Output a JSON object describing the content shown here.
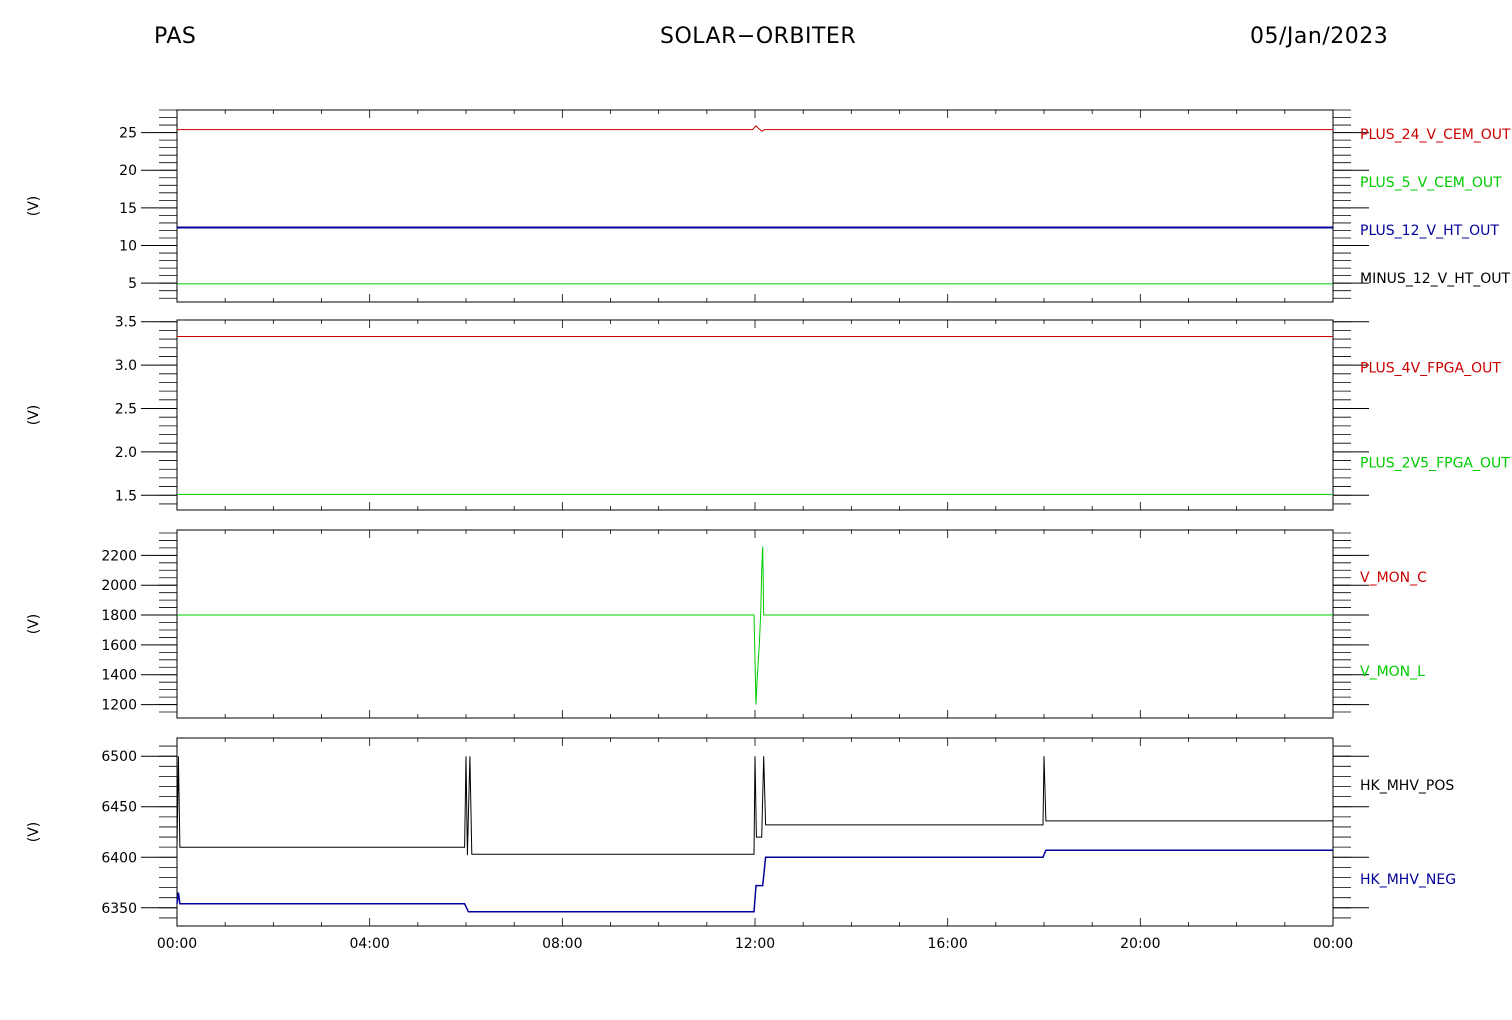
{
  "header": {
    "left": "PAS",
    "center": "SOLAR−ORBITER",
    "right": "05/Jan/2023"
  },
  "chart_data": [
    {
      "type": "line",
      "ylabel": "(V)",
      "ylim": [
        2.5,
        28
      ],
      "yticks": [
        {
          "v": 5,
          "label": "5"
        },
        {
          "v": 10,
          "label": "10"
        },
        {
          "v": 15,
          "label": "15"
        },
        {
          "v": 20,
          "label": "20"
        },
        {
          "v": 25,
          "label": "25"
        }
      ],
      "yminor": 1,
      "legend": [
        {
          "label": "PLUS_24_V_CEM_OUT",
          "color": "#cc0000"
        },
        {
          "label": "PLUS_5_V_CEM_OUT",
          "color": "#00cc00"
        },
        {
          "label": "PLUS_12_V_HT_OUT",
          "color": "#000099"
        },
        {
          "label": "MINUS_12_V_HT_OUT",
          "color": "#000000"
        }
      ],
      "series": [
        {
          "color": "#cc0000",
          "width": 1,
          "points": [
            [
              0,
              25.4
            ],
            [
              11.95,
              25.4
            ],
            [
              12.02,
              25.9
            ],
            [
              12.08,
              25.5
            ],
            [
              12.15,
              25.2
            ],
            [
              12.2,
              25.4
            ],
            [
              24,
              25.4
            ]
          ]
        },
        {
          "color": "#00cc00",
          "width": 1,
          "points": [
            [
              0,
              4.9
            ],
            [
              24,
              4.9
            ]
          ]
        },
        {
          "color": "#000099",
          "width": 2,
          "points": [
            [
              0,
              12.4
            ],
            [
              24,
              12.4
            ]
          ]
        }
      ]
    },
    {
      "type": "line",
      "ylabel": "(V)",
      "ylim": [
        1.33,
        3.52
      ],
      "yticks": [
        {
          "v": 1.5,
          "label": "1.5"
        },
        {
          "v": 2.0,
          "label": "2.0"
        },
        {
          "v": 2.5,
          "label": "2.5"
        },
        {
          "v": 3.0,
          "label": "3.0"
        },
        {
          "v": 3.5,
          "label": "3.5"
        }
      ],
      "yminor": 0.1,
      "legend": [
        {
          "label": "PLUS_4V_FPGA_OUT",
          "color": "#cc0000"
        },
        {
          "label": "PLUS_2V5_FPGA_OUT",
          "color": "#00cc00"
        }
      ],
      "series": [
        {
          "color": "#cc0000",
          "width": 1,
          "points": [
            [
              0,
              3.33
            ],
            [
              24,
              3.33
            ]
          ]
        },
        {
          "color": "#00cc00",
          "width": 1,
          "points": [
            [
              0,
              1.51
            ],
            [
              24,
              1.51
            ]
          ]
        }
      ]
    },
    {
      "type": "line",
      "ylabel": "(V)",
      "ylim": [
        1110,
        2370
      ],
      "yticks": [
        {
          "v": 1200,
          "label": "1200"
        },
        {
          "v": 1400,
          "label": "1400"
        },
        {
          "v": 1600,
          "label": "1600"
        },
        {
          "v": 1800,
          "label": "1800"
        },
        {
          "v": 2000,
          "label": "2000"
        },
        {
          "v": 2200,
          "label": "2200"
        }
      ],
      "yminor": 50,
      "legend": [
        {
          "label": "V_MON_C",
          "color": "#cc0000"
        },
        {
          "label": "V_MON_L",
          "color": "#00cc00"
        }
      ],
      "series": [
        {
          "color": "#00cc00",
          "width": 1,
          "points": [
            [
              0,
              1800
            ],
            [
              11.98,
              1800
            ],
            [
              12.02,
              1200
            ],
            [
              12.05,
              1400
            ],
            [
              12.09,
              1600
            ],
            [
              12.12,
              1830
            ],
            [
              12.14,
              2100
            ],
            [
              12.16,
              2260
            ],
            [
              12.18,
              1800
            ],
            [
              24,
              1800
            ]
          ]
        }
      ]
    },
    {
      "type": "line",
      "ylabel": "(V)",
      "ylim": [
        6332,
        6518
      ],
      "yticks": [
        {
          "v": 6350,
          "label": "6350"
        },
        {
          "v": 6400,
          "label": "6400"
        },
        {
          "v": 6450,
          "label": "6450"
        },
        {
          "v": 6500,
          "label": "6500"
        }
      ],
      "yminor": 10,
      "legend": [
        {
          "label": "HK_MHV_POS",
          "color": "#000000"
        },
        {
          "label": "HK_MHV_NEG",
          "color": "#000099"
        }
      ],
      "series": [
        {
          "color": "#000000",
          "width": 1,
          "points": [
            [
              0,
              6410
            ],
            [
              0.03,
              6500
            ],
            [
              0.06,
              6410
            ],
            [
              5.97,
              6410
            ],
            [
              6.0,
              6500
            ],
            [
              6.03,
              6402
            ],
            [
              6.08,
              6500
            ],
            [
              6.12,
              6403
            ],
            [
              11.98,
              6403
            ],
            [
              12.0,
              6500
            ],
            [
              12.03,
              6420
            ],
            [
              12.14,
              6420
            ],
            [
              12.18,
              6500
            ],
            [
              12.22,
              6432
            ],
            [
              17.98,
              6432
            ],
            [
              18.0,
              6500
            ],
            [
              18.04,
              6436
            ],
            [
              24,
              6436
            ]
          ]
        },
        {
          "color": "#000099",
          "width": 1.5,
          "points": [
            [
              0,
              6354
            ],
            [
              0.03,
              6365
            ],
            [
              0.06,
              6354
            ],
            [
              5.97,
              6354
            ],
            [
              6.05,
              6346
            ],
            [
              11.98,
              6346
            ],
            [
              12.02,
              6372
            ],
            [
              12.16,
              6372
            ],
            [
              12.22,
              6400
            ],
            [
              17.98,
              6400
            ],
            [
              18.04,
              6407
            ],
            [
              24,
              6407
            ]
          ]
        }
      ]
    }
  ],
  "xaxis": {
    "xlim": [
      0,
      24
    ],
    "ticks": [
      {
        "v": 0,
        "label": "00:00"
      },
      {
        "v": 4,
        "label": "04:00"
      },
      {
        "v": 8,
        "label": "08:00"
      },
      {
        "v": 12,
        "label": "12:00"
      },
      {
        "v": 16,
        "label": "16:00"
      },
      {
        "v": 20,
        "label": "20:00"
      },
      {
        "v": 24,
        "label": "00:00"
      }
    ],
    "minor": 1
  }
}
